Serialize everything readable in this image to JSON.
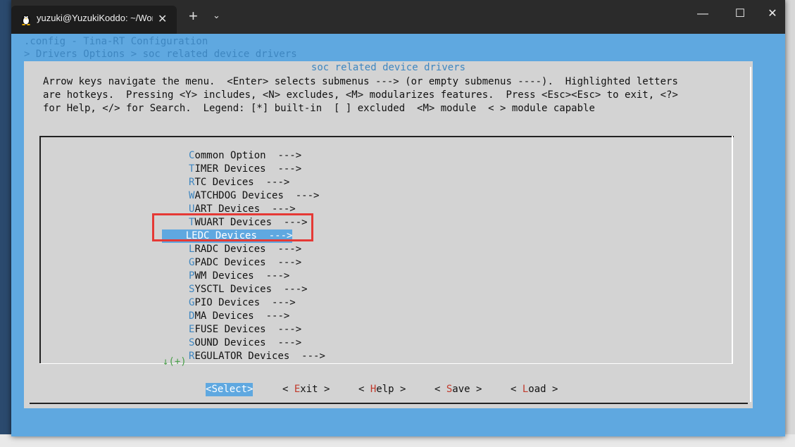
{
  "window": {
    "tab_title": "yuzuki@YuzukiKoddo: ~/Work",
    "tab_close": "✕",
    "new_tab": "+",
    "tab_dropdown": "⌄",
    "minimize": "—",
    "maximize": "☐",
    "close": "✕"
  },
  "terminal": {
    "line1": ".config - Tina-RT Configuration",
    "line2": "> Drivers Options > soc related device drivers"
  },
  "dialog": {
    "title": "soc related device drivers",
    "help_lines": [
      "Arrow keys navigate the menu.  <Enter> selects submenus ---> (or empty submenus ----).  Highlighted letters",
      "are hotkeys.  Pressing <Y> includes, <N> excludes, <M> modularizes features.  Press <Esc><Esc> to exit, <?>",
      "for Help, </> for Search.  Legend: [*] built-in  [ ] excluded  <M> module  < > module capable"
    ],
    "scroll_indicator": "↓(+)",
    "selected_index": 6,
    "items": [
      {
        "hotkey": "C",
        "rest": "ommon Option  --->"
      },
      {
        "hotkey": "T",
        "rest": "IMER Devices  --->"
      },
      {
        "hotkey": "R",
        "rest": "TC Devices  --->"
      },
      {
        "hotkey": "W",
        "rest": "ATCHDOG Devices  --->"
      },
      {
        "hotkey": "U",
        "rest": "ART Devices  --->"
      },
      {
        "hotkey": "T",
        "rest": "WUART Devices  --->"
      },
      {
        "hotkey": "L",
        "rest": "EDC Devices  --->"
      },
      {
        "hotkey": "L",
        "rest": "RADC Devices  --->"
      },
      {
        "hotkey": "G",
        "rest": "PADC Devices  --->"
      },
      {
        "hotkey": "P",
        "rest": "WM Devices  --->"
      },
      {
        "hotkey": "S",
        "rest": "YSCTL Devices  --->"
      },
      {
        "hotkey": "G",
        "rest": "PIO Devices  --->"
      },
      {
        "hotkey": "D",
        "rest": "MA Devices  --->"
      },
      {
        "hotkey": "E",
        "rest": "FUSE Devices  --->"
      },
      {
        "hotkey": "S",
        "rest": "OUND Devices  --->"
      },
      {
        "hotkey": "R",
        "rest": "EGULATOR Devices  --->"
      }
    ],
    "buttons": [
      {
        "pre": "<",
        "hotkey": "S",
        "rest": "elect>",
        "selected": true
      },
      {
        "pre": "< ",
        "hotkey": "E",
        "rest": "xit >",
        "selected": false
      },
      {
        "pre": "< ",
        "hotkey": "H",
        "rest": "elp >",
        "selected": false
      },
      {
        "pre": "< ",
        "hotkey": "S",
        "rest": "ave >",
        "selected": false
      },
      {
        "pre": "< ",
        "hotkey": "L",
        "rest": "oad >",
        "selected": false
      }
    ]
  },
  "colors": {
    "terminal_blue": "#5fa8e0",
    "dialog_gray": "#d3d3d3",
    "hotkey_blue": "#3e86c0",
    "button_hotkey_red": "#c0392b",
    "annotation_red": "#e53935"
  }
}
